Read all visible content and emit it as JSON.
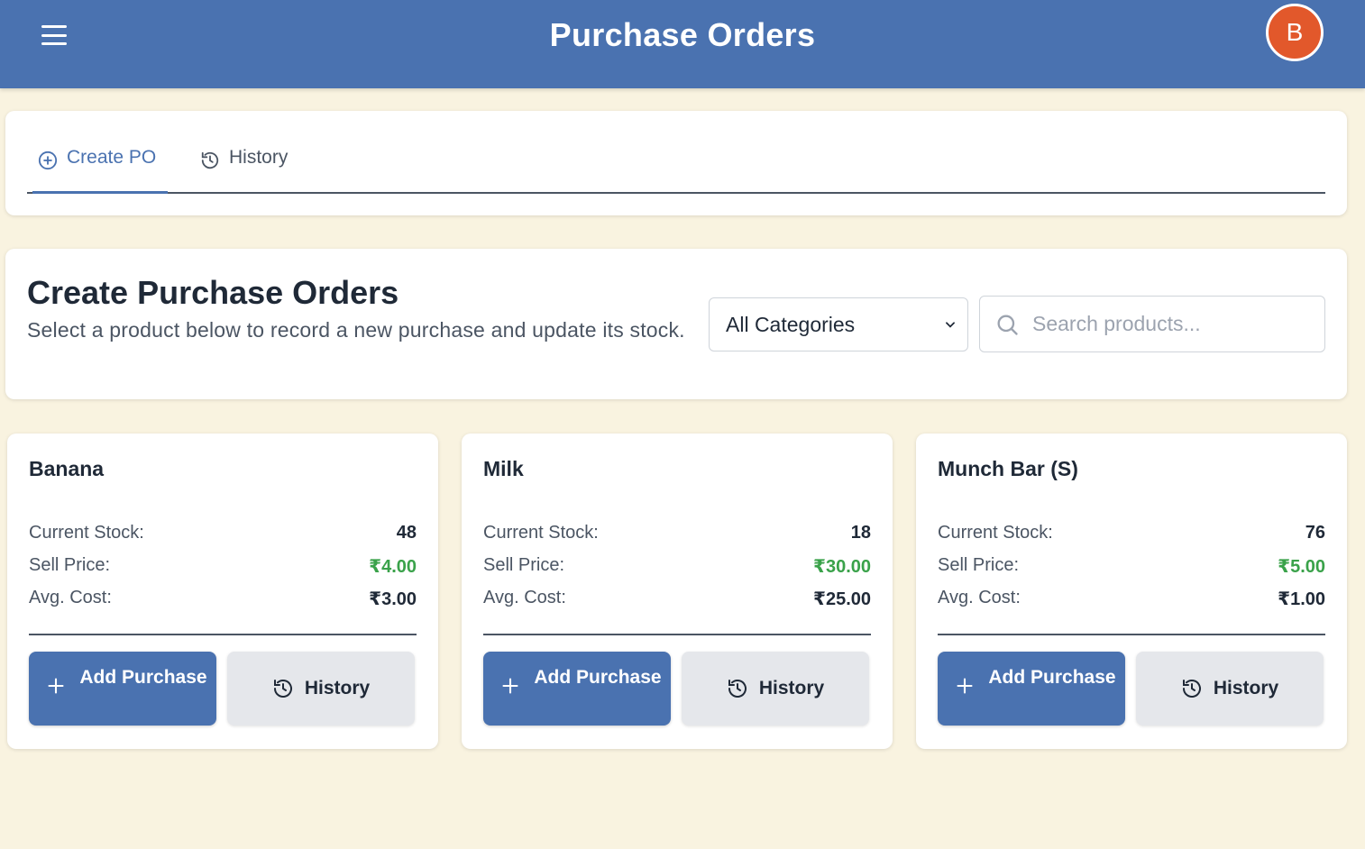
{
  "header": {
    "title": "Purchase Orders",
    "avatar_initial": "B"
  },
  "tabs": [
    {
      "label": "Create PO",
      "icon": "plus-circle-icon",
      "active": true
    },
    {
      "label": "History",
      "icon": "history-icon",
      "active": false
    }
  ],
  "intro": {
    "title": "Create Purchase Orders",
    "description": "Select a product below to record a new purchase and update its stock."
  },
  "filters": {
    "category_selected": "All Categories",
    "search_placeholder": "Search products...",
    "search_value": ""
  },
  "labels": {
    "current_stock": "Current Stock:",
    "sell_price": "Sell Price:",
    "avg_cost": "Avg. Cost:",
    "add_purchase": "Add Purchase",
    "history": "History"
  },
  "products": [
    {
      "name": "Banana",
      "current_stock": "48",
      "sell_price": "₹4.00",
      "avg_cost": "₹3.00"
    },
    {
      "name": "Milk",
      "current_stock": "18",
      "sell_price": "₹30.00",
      "avg_cost": "₹25.00"
    },
    {
      "name": "Munch Bar (S)",
      "current_stock": "76",
      "sell_price": "₹5.00",
      "avg_cost": "₹1.00"
    }
  ],
  "colors": {
    "primary": "#4a72b0",
    "avatar": "#e2582b",
    "price_green": "#3aa24a",
    "background": "#f9f3e0"
  }
}
